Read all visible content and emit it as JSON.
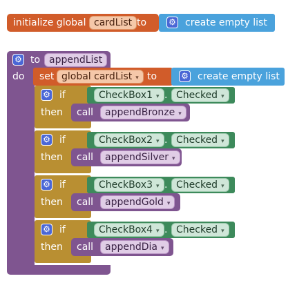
{
  "init_block": {
    "keyword": "initialize global",
    "var_name": "cardList",
    "to": "to",
    "value": "create empty list"
  },
  "procedure": {
    "to": "to",
    "name": "appendList",
    "do": "do",
    "set_keyword": "set",
    "set_var": "global cardList",
    "set_to": "to",
    "set_value": "create empty list"
  },
  "if_blocks": [
    {
      "if": "if",
      "then": "then",
      "component": "CheckBox1",
      "property": "Checked",
      "call": "call",
      "proc": "appendBronze"
    },
    {
      "if": "if",
      "then": "then",
      "component": "CheckBox2",
      "property": "Checked",
      "call": "call",
      "proc": "appendSilver"
    },
    {
      "if": "if",
      "then": "then",
      "component": "CheckBox3",
      "property": "Checked",
      "call": "call",
      "proc": "appendGold"
    },
    {
      "if": "if",
      "then": "then",
      "component": "CheckBox4",
      "property": "Checked",
      "call": "call",
      "proc": "appendDia"
    }
  ],
  "dot": ".",
  "dropdown_glyph": "▾",
  "icons": {
    "mutator": "gear-icon"
  },
  "colors": {
    "variables": "#d15c2a",
    "lists": "#4aa2dc",
    "procedures": "#7f5590",
    "control": "#b98f32",
    "components": "#3d8a5b"
  }
}
